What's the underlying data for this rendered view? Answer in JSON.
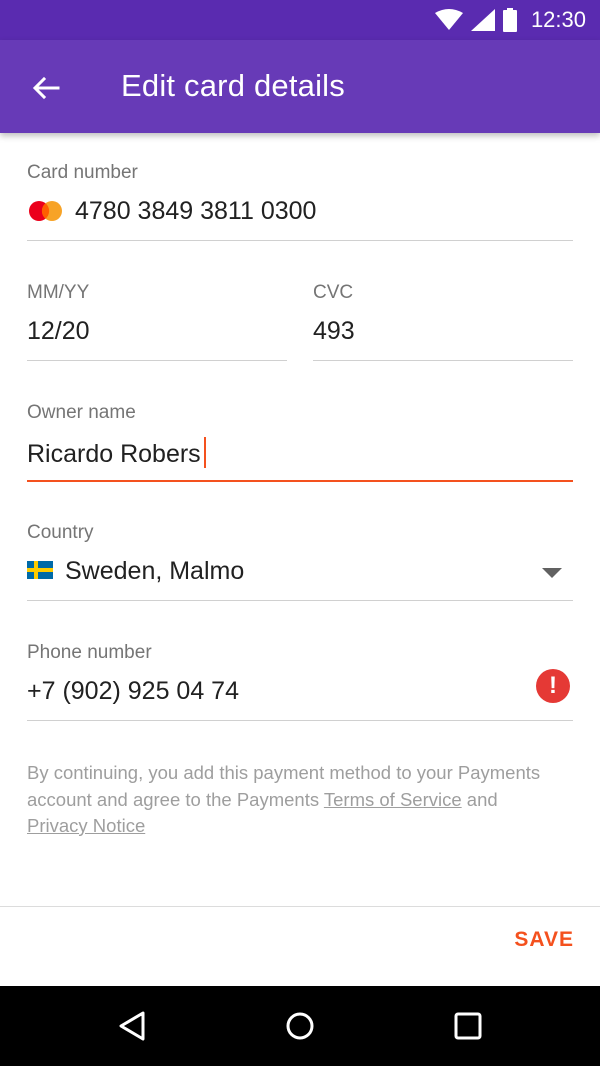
{
  "status_bar": {
    "time": "12:30"
  },
  "app_bar": {
    "title": "Edit card details"
  },
  "form": {
    "card_number": {
      "label": "Card number",
      "value": "4780 3849 3811 0300"
    },
    "expiry": {
      "label": "MM/YY",
      "value": "12/20"
    },
    "cvc": {
      "label": "CVC",
      "value": "493"
    },
    "owner_name": {
      "label": "Owner name",
      "value": "Ricardo Robers"
    },
    "country": {
      "label": "Country",
      "value": "Sweden, Malmo"
    },
    "phone": {
      "label": "Phone number",
      "value": "+7 (902) 925 04 74",
      "error_glyph": "!"
    }
  },
  "legal": {
    "text_1": "By continuing, you add this payment method to your Payments account and agree to the Payments ",
    "terms_link": "Terms of Service",
    "text_2": " and ",
    "privacy_link": "Privacy Notice"
  },
  "actions": {
    "save_label": "SAVE"
  },
  "colors": {
    "status_bar": "#5a2bb0",
    "app_bar": "#673ab7",
    "accent": "#f4511e",
    "error": "#e53935"
  },
  "icons": [
    "wifi-icon",
    "signal-icon",
    "battery-icon",
    "back-arrow-icon",
    "mastercard-logo-icon",
    "sweden-flag-icon",
    "dropdown-arrow-icon",
    "error-icon",
    "nav-back-icon",
    "nav-home-icon",
    "nav-recents-icon"
  ]
}
